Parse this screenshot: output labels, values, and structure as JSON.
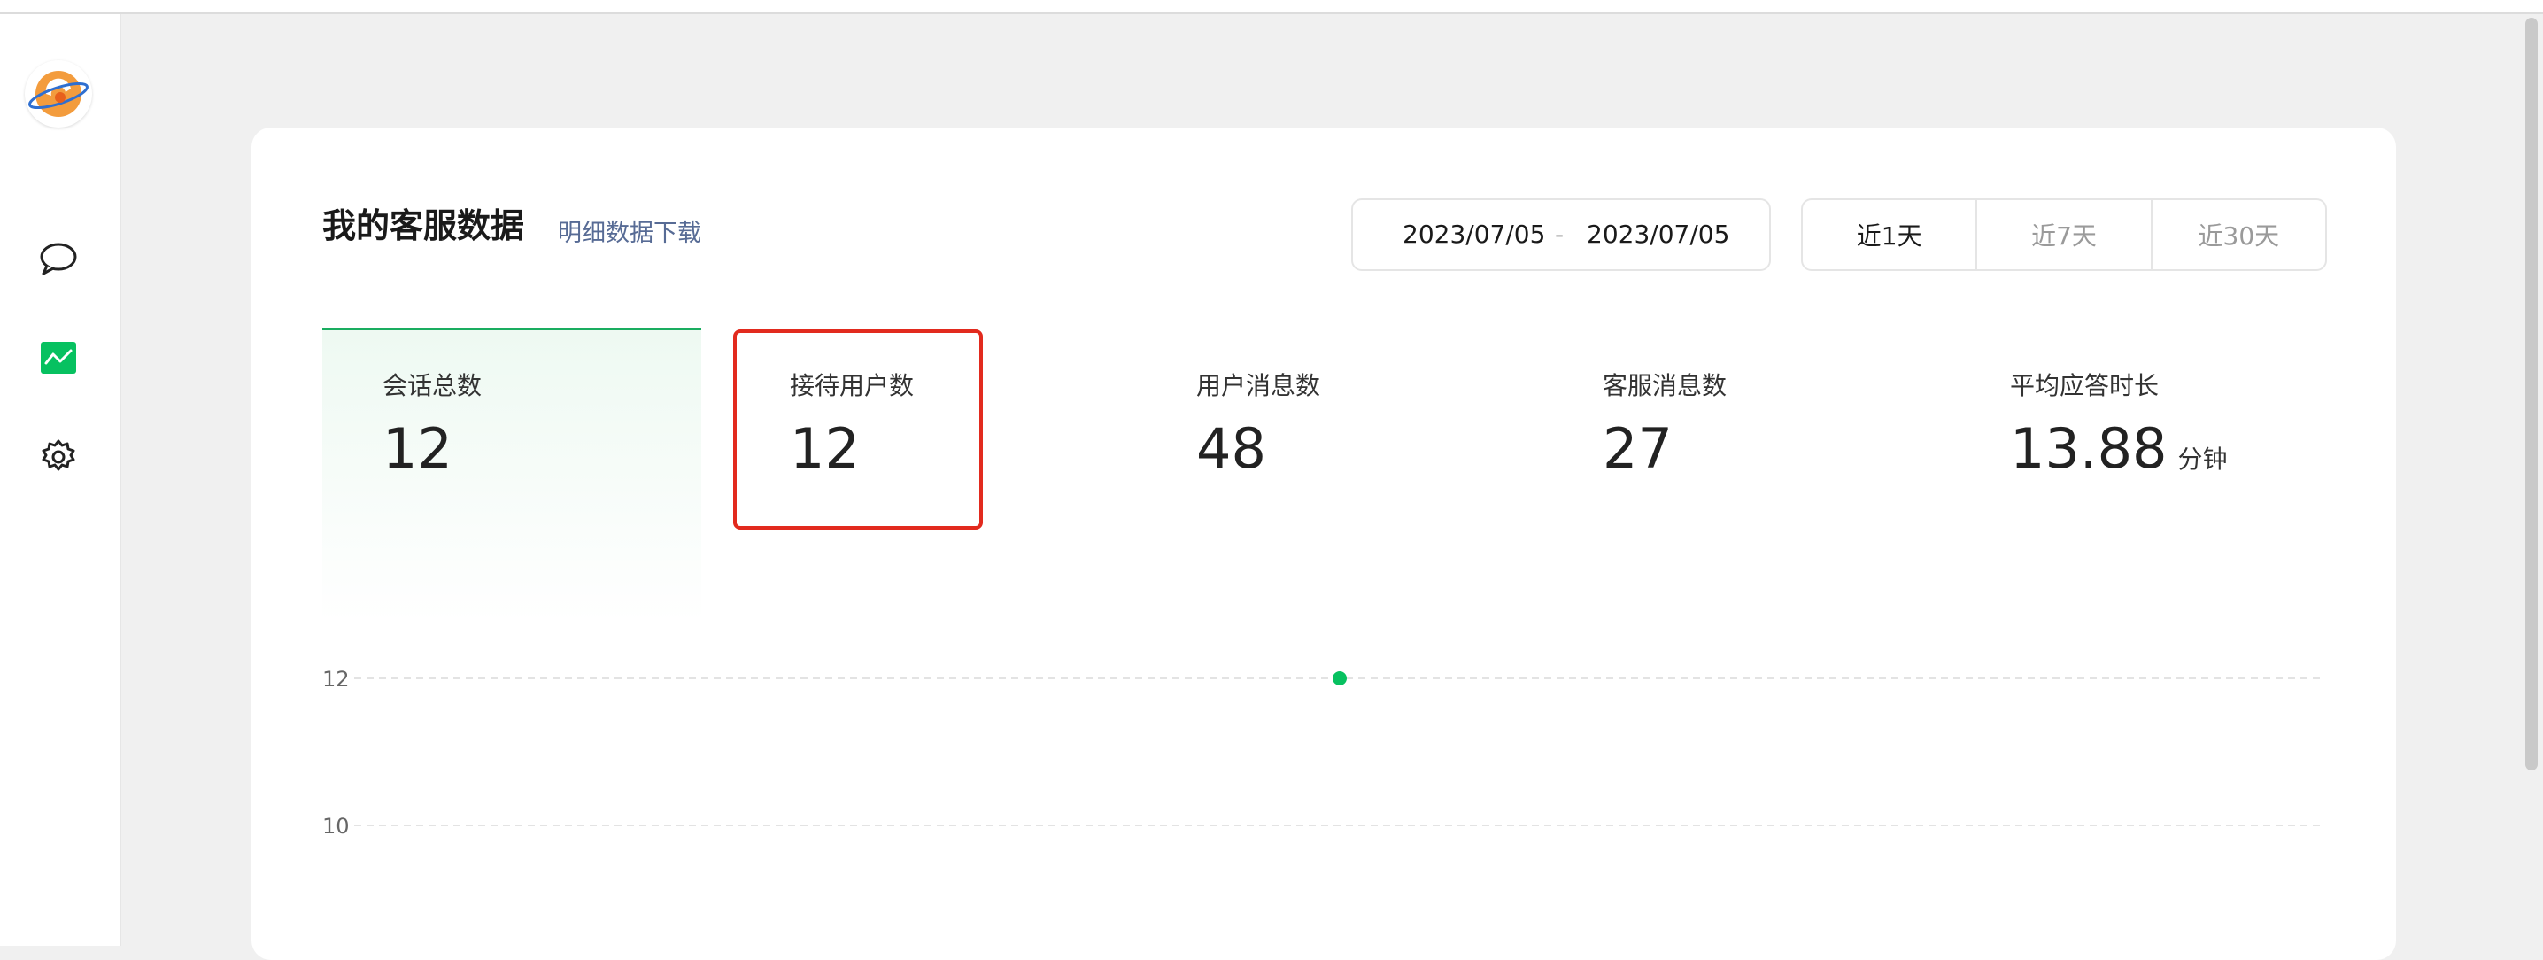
{
  "sidebar": {
    "icons": [
      "logo",
      "chat-icon",
      "data-chart-icon",
      "gear-icon"
    ],
    "active_color": "#07c160"
  },
  "header": {
    "title": "我的客服数据",
    "download_link": "明细数据下载"
  },
  "date_range": {
    "start": "2023/07/05",
    "separator": "-",
    "end": "2023/07/05"
  },
  "range_tabs": [
    {
      "label": "近1天",
      "active": true
    },
    {
      "label": "近7天",
      "active": false
    },
    {
      "label": "近30天",
      "active": false
    }
  ],
  "metrics": [
    {
      "label": "会话总数",
      "value": "12",
      "active": true
    },
    {
      "label": "接待用户数",
      "value": "12",
      "highlighted": true
    },
    {
      "label": "用户消息数",
      "value": "48"
    },
    {
      "label": "客服消息数",
      "value": "27"
    },
    {
      "label": "平均应答时长",
      "value": "13.88",
      "unit": "分钟"
    }
  ],
  "chart_data": {
    "type": "line",
    "title": "",
    "xlabel": "",
    "ylabel": "",
    "y_ticks": [
      "12",
      "10"
    ],
    "ylim": [
      10,
      12
    ],
    "grid": true,
    "series": [
      {
        "points": [
          {
            "y": 12
          }
        ],
        "color": "#07c160"
      }
    ]
  },
  "colors": {
    "accent": "#07c160",
    "link": "#576b95",
    "highlight_box": "#e22a1e"
  }
}
